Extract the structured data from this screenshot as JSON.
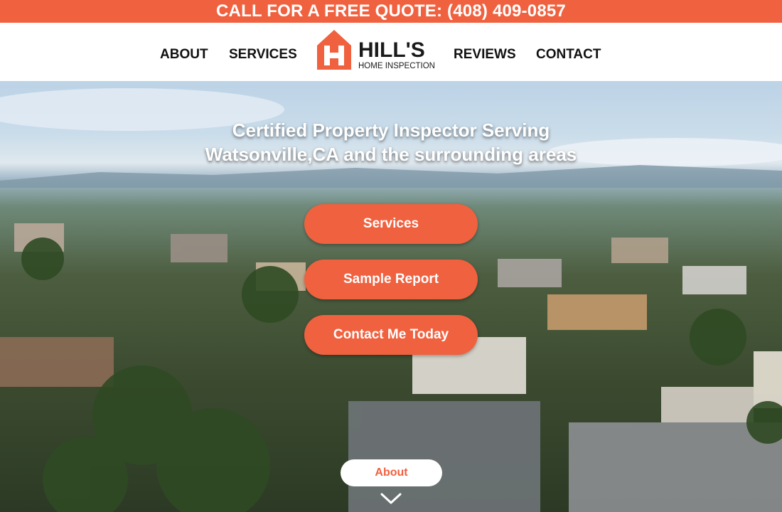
{
  "topbar": {
    "text": "CALL FOR A FREE QUOTE: (408) 409-0857"
  },
  "nav": {
    "about": "ABOUT",
    "services": "SERVICES",
    "reviews": "REVIEWS",
    "contact": "CONTACT"
  },
  "logo": {
    "icon": "house-h-logo-icon",
    "name": "HILL'S",
    "tagline": "HOME INSPECTION"
  },
  "hero": {
    "title_line1": "Certified Property Inspector Serving",
    "title_line2": "Watsonville,CA and the surrounding areas",
    "buttons": {
      "services": "Services",
      "sample_report": "Sample Report",
      "contact": "Contact Me Today"
    },
    "about_button": "About",
    "scroll_icon": "chevron-down-icon"
  },
  "colors": {
    "accent": "#f0613f",
    "nav_text": "#111111",
    "white": "#ffffff"
  }
}
